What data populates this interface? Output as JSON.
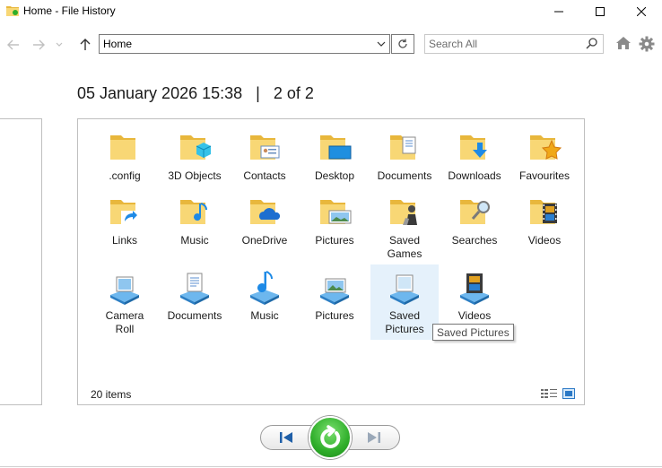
{
  "window": {
    "title": "Home - File History"
  },
  "nav": {
    "address": "Home",
    "search_placeholder": "Search All"
  },
  "header": {
    "date": "05 January 2026 15:38",
    "separator": "|",
    "position": "2 of 2"
  },
  "items": [
    {
      "label": "",
      "label1": ".config",
      "label2": "",
      "icon": "folder-icon"
    },
    {
      "label1": "3D Objects",
      "label2": "",
      "icon": "3d-objects-folder-icon"
    },
    {
      "label1": "Contacts",
      "label2": "",
      "icon": "contacts-folder-icon"
    },
    {
      "label1": "Desktop",
      "label2": "",
      "icon": "desktop-folder-icon"
    },
    {
      "label1": "Documents",
      "label2": "",
      "icon": "documents-folder-icon"
    },
    {
      "label1": "Downloads",
      "label2": "",
      "icon": "downloads-folder-icon"
    },
    {
      "label1": "Favourites",
      "label2": "",
      "icon": "favourites-folder-icon"
    },
    {
      "label1": "Links",
      "label2": "",
      "icon": "links-folder-icon"
    },
    {
      "label1": "Music",
      "label2": "",
      "icon": "music-folder-icon"
    },
    {
      "label1": "OneDrive",
      "label2": "",
      "icon": "onedrive-folder-icon"
    },
    {
      "label1": "Pictures",
      "label2": "",
      "icon": "pictures-folder-icon"
    },
    {
      "label1": "Saved",
      "label2": "Games",
      "icon": "saved-games-folder-icon"
    },
    {
      "label1": "Searches",
      "label2": "",
      "icon": "searches-folder-icon"
    },
    {
      "label1": "Videos",
      "label2": "",
      "icon": "videos-folder-icon"
    },
    {
      "label1": "Camera",
      "label2": "Roll",
      "icon": "camera-roll-library-icon"
    },
    {
      "label1": "Documents",
      "label2": "",
      "icon": "documents-library-icon"
    },
    {
      "label1": "Music",
      "label2": "",
      "icon": "music-library-icon"
    },
    {
      "label1": "Pictures",
      "label2": "",
      "icon": "pictures-library-icon"
    },
    {
      "label1": "Saved",
      "label2": "Pictures",
      "icon": "saved-pictures-library-icon"
    },
    {
      "label1": "Videos",
      "label2": "",
      "icon": "videos-library-icon"
    }
  ],
  "status": {
    "count": "20 items"
  },
  "tooltip": {
    "text": "Saved Pictures"
  },
  "colors": {
    "folder": "#f8d775",
    "folder_dark": "#e8b73c",
    "accent": "#0078d7",
    "restore_green": "#2fae2a",
    "selection": "#e5f1fb"
  }
}
